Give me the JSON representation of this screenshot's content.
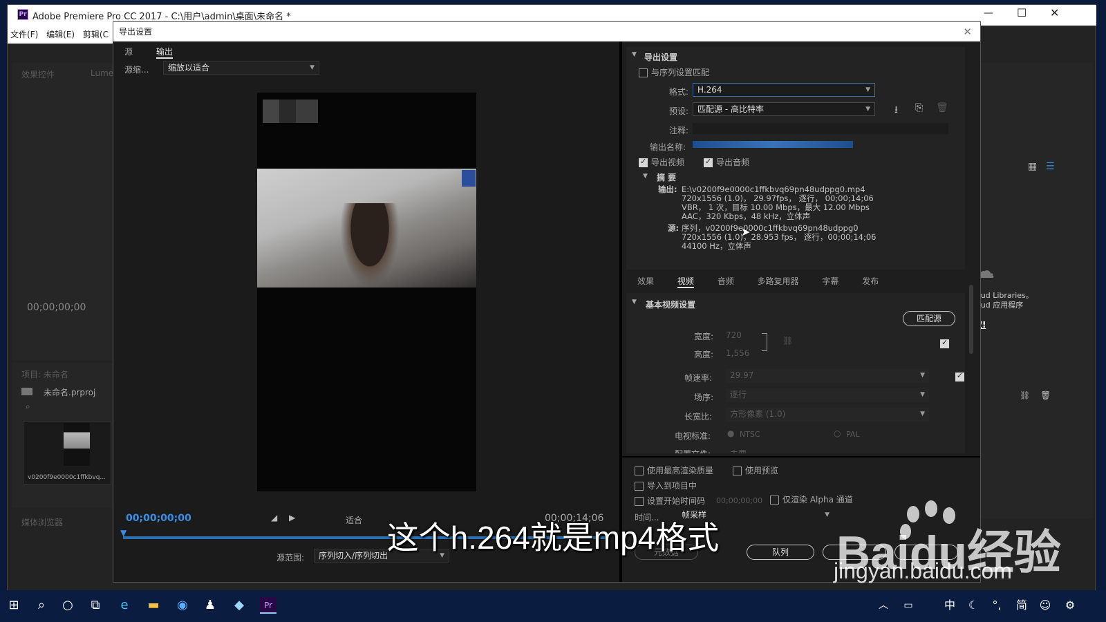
{
  "app": {
    "title": "Adobe Premiere Pro CC 2017 - C:\\用户\\admin\\桌面\\未命名 *",
    "menus": [
      "文件(F)",
      "编辑(E)",
      "剪辑(C"
    ],
    "left_panels": {
      "effects_tab": "效果控件",
      "lumetri_tab": "Lume",
      "timecode": "00;00;00;00",
      "project_title": "项目: 未命名",
      "project_file": "未命名.prproj",
      "clip_name": "v0200f9e0000c1ffkbvq...",
      "media_browser": "媒体浏览器"
    },
    "right_bg": {
      "libraries_text1": "loud Libraries。",
      "libraries_text2": "loud 应用程序",
      "libraries_link": "取!"
    }
  },
  "dialog": {
    "title": "导出设置",
    "source_tabs": [
      "源",
      "输出"
    ],
    "source_scaling_label": "源缩...",
    "source_scaling_value": "缩放以适合",
    "current_time": "00;00;00;00",
    "fit_label": "适合",
    "end_time": "00;00;14;06",
    "range_label": "源范围:",
    "range_value": "序列切入/序列切出",
    "export_settings": {
      "header": "导出设置",
      "match_sequence": "与序列设置匹配",
      "format_label": "格式:",
      "format_value": "H.264",
      "preset_label": "预设:",
      "preset_value": "匹配源 - 高比特率",
      "comment_label": "注释:",
      "output_name_label": "输出名称:",
      "export_video": "导出视频",
      "export_audio": "导出音频",
      "summary_header": "摘 要",
      "output_label": "输出:",
      "output_lines": [
        "E:\\v0200f9e0000c1ffkbvq69pn48udppg0.mp4",
        "720x1556 (1.0)， 29.97fps， 逐行， 00;00;14;06",
        "VBR， 1 次，目标 10.00 Mbps，最大 12.00 Mbps",
        "AAC，320 Kbps，48 kHz，立体声"
      ],
      "source_label": "源:",
      "source_lines": [
        "序列，v0200f9e0000c1ffkbvq69pn48udppg0",
        "720x1556 (1.0)，28.953 fps， 逐行，00;00;14;06",
        "44100 Hz，立体声"
      ]
    },
    "settings_tabs": [
      "效果",
      "视频",
      "音频",
      "多路复用器",
      "字幕",
      "发布"
    ],
    "video": {
      "header": "基本视频设置",
      "match_source": "匹配源",
      "width_label": "宽度:",
      "width_value": "720",
      "height_label": "高度:",
      "height_value": "1,556",
      "fps_label": "帧速率:",
      "fps_value": "29.97",
      "field_label": "场序:",
      "field_value": "逐行",
      "aspect_label": "长宽比:",
      "aspect_value": "方形像素 (1.0)",
      "tv_label": "电视标准:",
      "ntsc": "NTSC",
      "pal": "PAL",
      "profile_label": "配置文件:",
      "profile_value": "主要"
    },
    "bottom": {
      "max_render": "使用最高渲染质量",
      "use_preview": "使用预览",
      "import_project": "导入到项目中",
      "set_timecode": "设置开始时间码",
      "timecode_value": "00;00;00;00",
      "alpha_only": "仅渲染 Alpha 通道",
      "time_interp_label": "时间...",
      "time_interp_value": "帧采样",
      "metadata_btn": "元数据",
      "queue_btn": "队列"
    }
  },
  "subtitle": "这个h.264就是mp4格式",
  "watermark": {
    "logo_text": "Baidu经验",
    "url": "jingyan.baidu.com"
  },
  "taskbar": {
    "ime": "中",
    "simplified": "简"
  },
  "colors": {
    "app_bg": "#232323",
    "dialog_bg": "#1e1e1e",
    "timecode_blue": "#3a8ee6",
    "format_border": "#3a6ea8"
  }
}
